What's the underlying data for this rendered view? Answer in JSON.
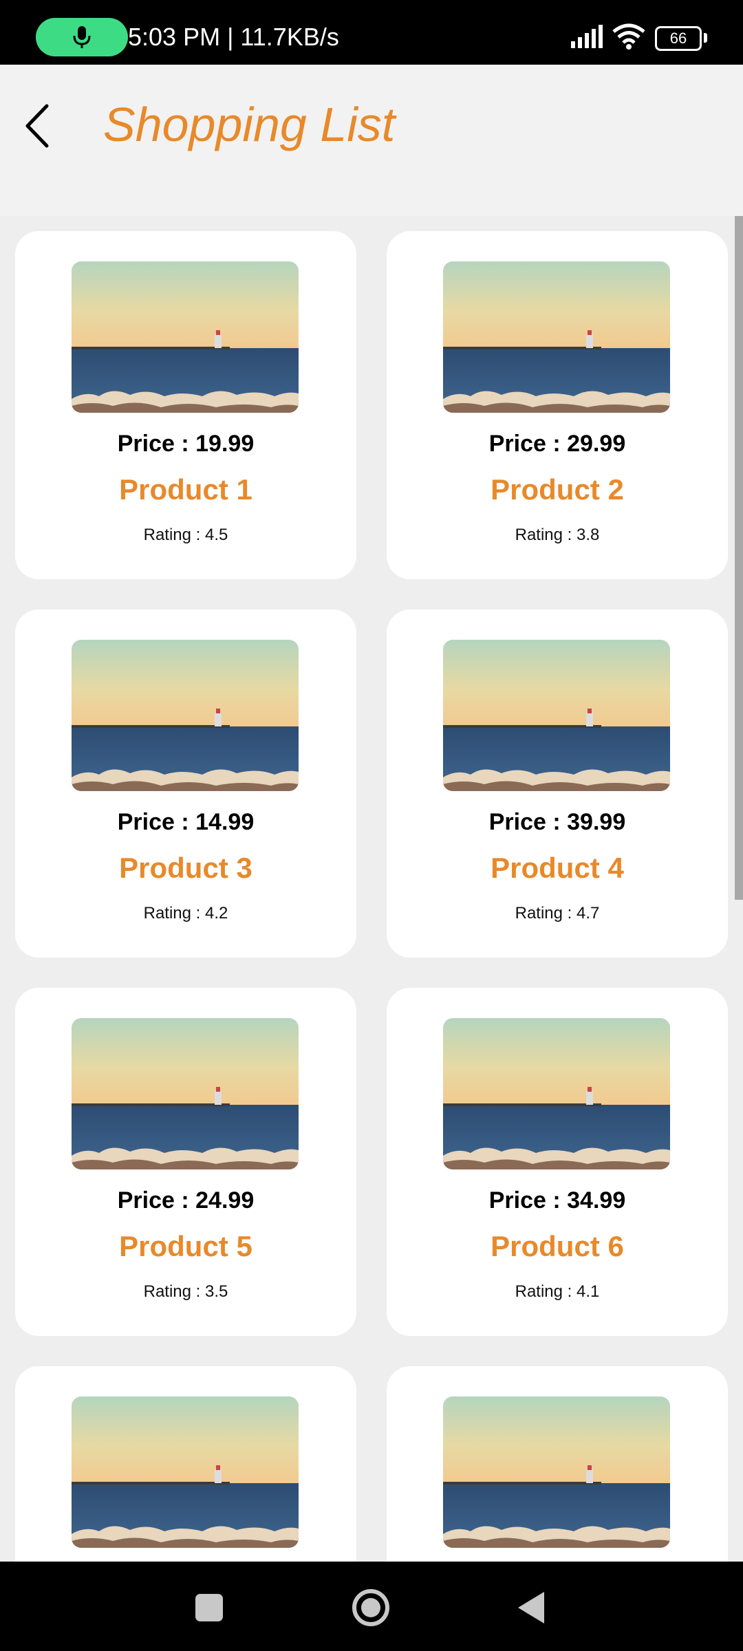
{
  "status_bar": {
    "text": "5:03 PM | 11.7KB/s",
    "battery": "66",
    "icons": [
      "mic-icon",
      "signal-icon",
      "wifi-icon",
      "battery-icon"
    ]
  },
  "app_bar": {
    "title": "Shopping List",
    "back_icon": "chevron-left-icon",
    "accent_color": "#e8892a"
  },
  "products": [
    {
      "price": "Price : 19.99",
      "name": "Product 1",
      "rating": "Rating : 4.5"
    },
    {
      "price": "Price : 29.99",
      "name": "Product 2",
      "rating": "Rating : 3.8"
    },
    {
      "price": "Price : 14.99",
      "name": "Product 3",
      "rating": "Rating : 4.2"
    },
    {
      "price": "Price : 39.99",
      "name": "Product 4",
      "rating": "Rating : 4.7"
    },
    {
      "price": "Price : 24.99",
      "name": "Product 5",
      "rating": "Rating : 3.5"
    },
    {
      "price": "Price : 34.99",
      "name": "Product 6",
      "rating": "Rating : 4.1"
    },
    {
      "price": "",
      "name": "",
      "rating": ""
    },
    {
      "price": "",
      "name": "",
      "rating": ""
    }
  ],
  "nav_bar": {
    "icons": [
      "recents-square-icon",
      "home-circle-icon",
      "back-triangle-icon"
    ]
  }
}
